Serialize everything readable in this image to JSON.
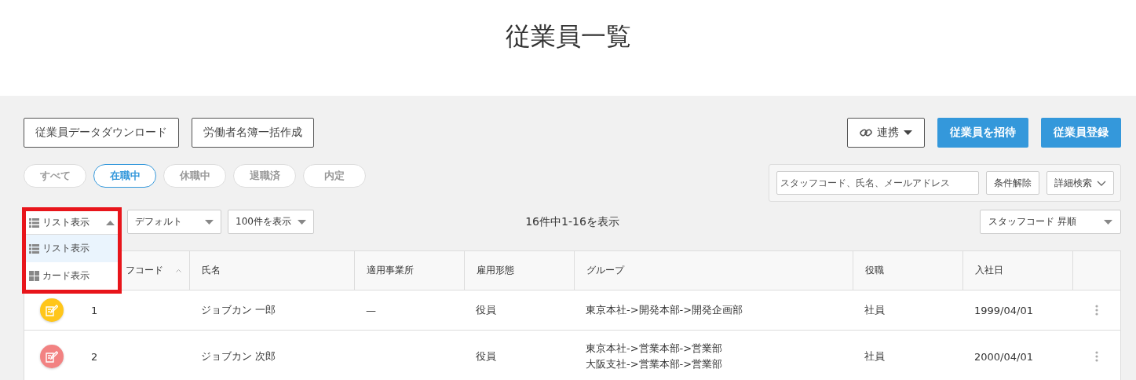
{
  "page_title": "従業員一覧",
  "toolbar": {
    "left_buttons": [
      "従業員データダウンロード",
      "労働者名簿一括作成"
    ],
    "link_button": "連携",
    "primary_buttons": [
      "従業員を招待",
      "従業員登録"
    ]
  },
  "status_filters": [
    {
      "label": "すべて",
      "selected": false
    },
    {
      "label": "在職中",
      "selected": true
    },
    {
      "label": "休職中",
      "selected": false
    },
    {
      "label": "退職済",
      "selected": false
    },
    {
      "label": "内定",
      "selected": false
    }
  ],
  "search": {
    "placeholder": "スタッフコード、氏名、メールアドレス",
    "clear_button": "条件解除",
    "advanced_button": "詳細検索"
  },
  "view_select": {
    "value": "リスト表示",
    "expanded": true,
    "options": [
      {
        "label": "リスト表示",
        "kind": "list",
        "selected": true
      },
      {
        "label": "カード表示",
        "kind": "card",
        "selected": false
      }
    ]
  },
  "filter_select": "デフォルト",
  "page_size_select": "100件を表示",
  "result_count": "16件中1-16を表示",
  "sort_select": "スタッフコード 昇順",
  "table": {
    "columns": [
      {
        "label": "フコード",
        "sorted": true
      },
      {
        "label": "氏名",
        "sorted": false
      },
      {
        "label": "適用事業所",
        "sorted": false
      },
      {
        "label": "雇用形態",
        "sorted": false
      },
      {
        "label": "グループ",
        "sorted": false
      },
      {
        "label": "役職",
        "sorted": false
      },
      {
        "label": "入社日",
        "sorted": false
      }
    ],
    "rows": [
      {
        "color": "#ffc61a",
        "code": "1",
        "name": "ジョブカン 一郎",
        "office": "—",
        "employment": "役員",
        "groups": [
          "東京本社->開発本部->開発企画部"
        ],
        "position": "社員",
        "hire_date": "1999/04/01"
      },
      {
        "color": "#f28282",
        "code": "2",
        "name": "ジョブカン 次郎",
        "employment": "役員",
        "groups": [
          "東京本社->営業本部->営業部",
          "大阪支社->営業本部->営業部"
        ],
        "position": "社員",
        "hire_date": "2000/04/01"
      }
    ]
  }
}
